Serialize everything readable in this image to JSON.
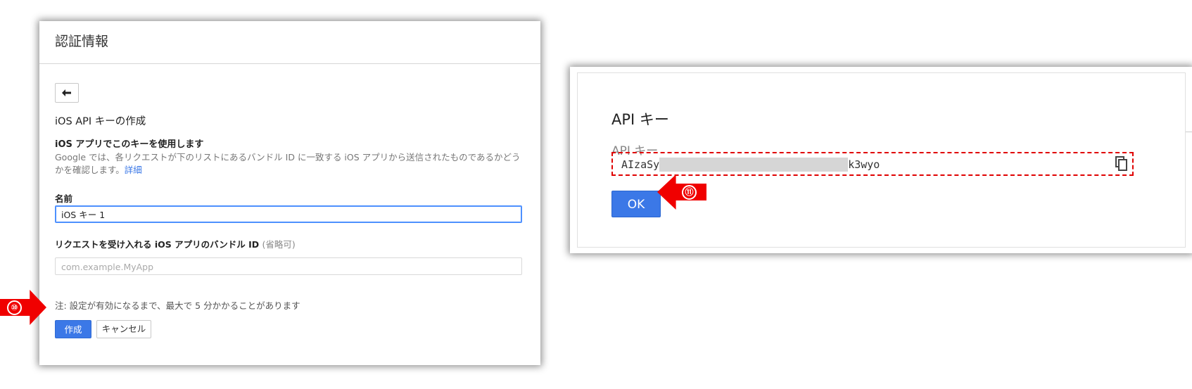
{
  "left_panel": {
    "header_title": "認証情報",
    "back_icon": "back-arrow-icon",
    "title": "iOS API キーの作成",
    "subtitle": "iOS アプリでこのキーを使用します",
    "description": "Google では、各リクエストが下のリストにあるバンドル ID に一致する iOS アプリから送信されたものであるかどうかを確認します。",
    "details_link": "詳細",
    "name_label": "名前",
    "name_value": "iOS キー 1",
    "bundle_label": "リクエストを受け入れる iOS アプリのバンドル ID",
    "bundle_optional": "(省略可)",
    "bundle_placeholder": "com.example.MyApp",
    "note": "注: 設定が有効になるまで、最大で 5 分かかることがあります",
    "create_button": "作成",
    "cancel_button": "キャンセル"
  },
  "right_panel": {
    "title": "API キー",
    "key_label": "API キー",
    "key_prefix": "AIzaSy",
    "key_suffix": "k3wyo",
    "copy_icon": "copy-icon",
    "ok_button": "OK"
  },
  "annotations": {
    "step_10": "⑩",
    "step_11": "⑪",
    "arrow_color": "#f00000"
  },
  "colors": {
    "primary_button": "#3b78e7",
    "link": "#3b78e7",
    "highlight_border": "#e00000"
  }
}
